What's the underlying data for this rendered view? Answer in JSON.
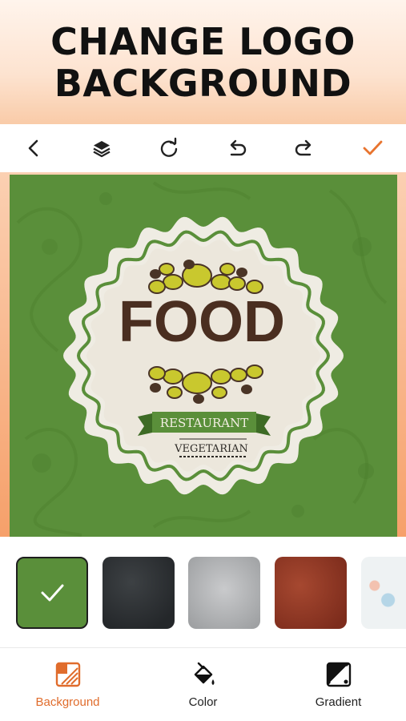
{
  "hero": {
    "line1": "CHANGE LOGO",
    "line2": "BACKGROUND"
  },
  "toolbar": {
    "icons": [
      "back-icon",
      "layers-icon",
      "rotate-icon",
      "undo-icon",
      "redo-icon",
      "confirm-check-icon"
    ],
    "accent_color": "#e8742f"
  },
  "logo": {
    "title": "FOOD",
    "ribbon_text": "RESTAURANT",
    "subtitle": "VEGETARIAN",
    "background_color": "#5a8f3a"
  },
  "background_swatches": [
    {
      "name": "green-pattern",
      "selected": true
    },
    {
      "name": "black-chalkboard",
      "selected": false
    },
    {
      "name": "silver-texture",
      "selected": false
    },
    {
      "name": "red-grunge",
      "selected": false
    },
    {
      "name": "watercolor",
      "selected": false
    }
  ],
  "tabs": [
    {
      "label": "Background",
      "icon": "background-icon",
      "active": true
    },
    {
      "label": "Color",
      "icon": "paint-bucket-icon",
      "active": false
    },
    {
      "label": "Gradient",
      "icon": "gradient-icon",
      "active": false
    }
  ]
}
